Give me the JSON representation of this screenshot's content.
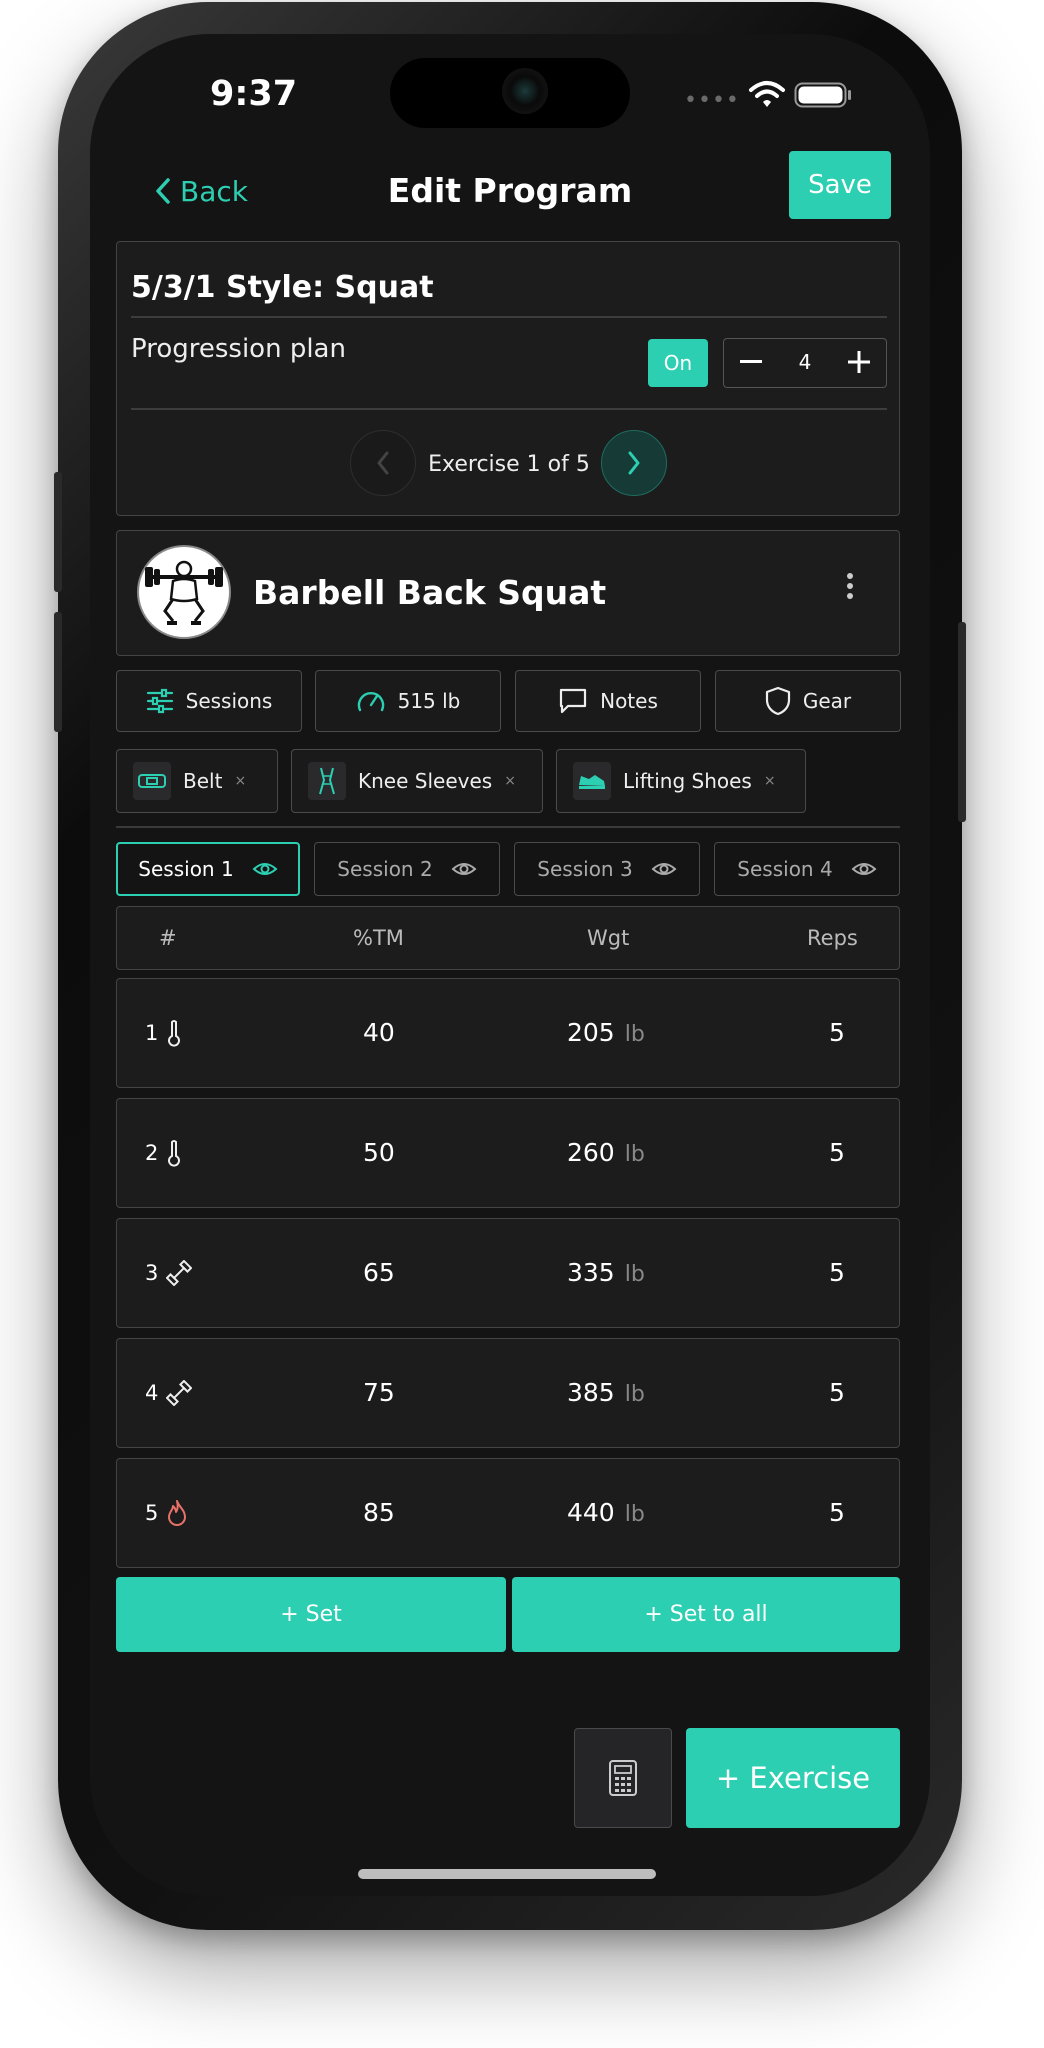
{
  "status_bar": {
    "time": "9:37",
    "cellular_icon": "signal-dots-icon",
    "wifi_icon": "wifi-icon",
    "battery_icon": "battery-icon"
  },
  "nav": {
    "back_label": "Back",
    "title": "Edit Program",
    "save_label": "Save"
  },
  "program": {
    "name": "5/3/1 Style: Squat",
    "progression_label": "Progression plan",
    "progression_toggle": "On",
    "progression_value": "4",
    "exercise_position": "Exercise 1 of 5"
  },
  "exercise": {
    "name": "Barbell Back Squat",
    "tiles": [
      {
        "label": "Sessions",
        "icon": "sliders-icon"
      },
      {
        "label": "515 lb",
        "icon": "gauge-icon"
      },
      {
        "label": "Notes",
        "icon": "speech-bubble-icon"
      },
      {
        "label": "Gear",
        "icon": "shield-icon"
      }
    ],
    "gear": [
      {
        "label": "Belt",
        "icon": "belt-icon"
      },
      {
        "label": "Knee Sleeves",
        "icon": "knee-sleeve-icon"
      },
      {
        "label": "Lifting Shoes",
        "icon": "shoe-icon"
      }
    ],
    "remove_glyph": "×"
  },
  "sessions": [
    {
      "label": "Session 1",
      "active": true
    },
    {
      "label": "Session 2",
      "active": false
    },
    {
      "label": "Session 3",
      "active": false
    },
    {
      "label": "Session 4",
      "active": false
    }
  ],
  "table": {
    "headers": {
      "num": "#",
      "tm": "%TM",
      "wgt": "Wgt",
      "reps": "Reps"
    },
    "unit": "lb",
    "rows": [
      {
        "n": "1",
        "type_icon": "thermometer-icon",
        "tm": "40",
        "wgt": "205",
        "reps": "5"
      },
      {
        "n": "2",
        "type_icon": "thermometer-icon",
        "tm": "50",
        "wgt": "260",
        "reps": "5"
      },
      {
        "n": "3",
        "type_icon": "dumbbell-icon",
        "tm": "65",
        "wgt": "335",
        "reps": "5"
      },
      {
        "n": "4",
        "type_icon": "dumbbell-icon",
        "tm": "75",
        "wgt": "385",
        "reps": "5"
      },
      {
        "n": "5",
        "type_icon": "flame-icon",
        "tm": "85",
        "wgt": "440",
        "reps": "5"
      }
    ]
  },
  "actions": {
    "add_set": "+ Set",
    "add_set_all": "+ Set to all",
    "add_exercise": "+ Exercise",
    "calculator_icon": "calculator-icon"
  },
  "colors": {
    "accent": "#2ccfb1",
    "background": "#141415",
    "card": "#1c1c1d",
    "flame": "#e8726a"
  }
}
